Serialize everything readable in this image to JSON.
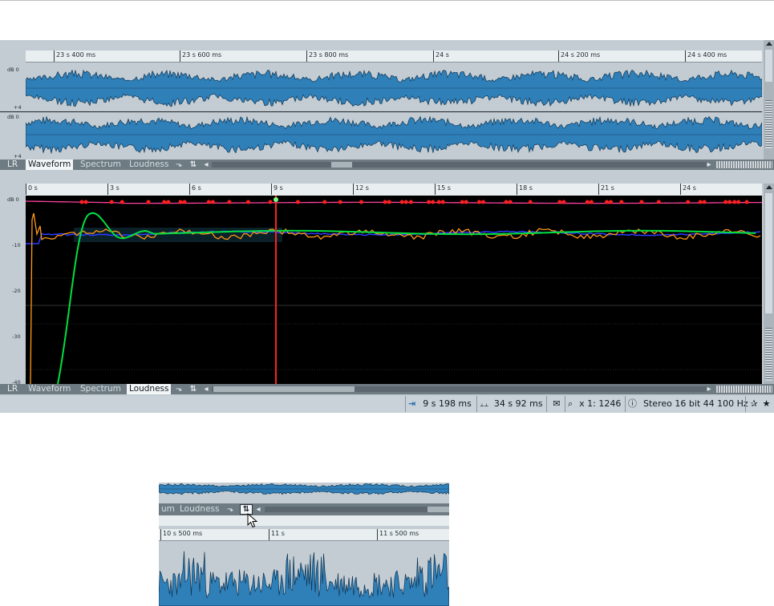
{
  "top_ruler": {
    "labels": [
      "23 s 400 ms",
      "23 s 600 ms",
      "23 s 800 ms",
      "24 s",
      "24 s 200 ms",
      "24 s 400 ms"
    ]
  },
  "top_channels": [
    {
      "top_label": "dB 0",
      "bottom_label": "+4"
    },
    {
      "top_label": "dB 0",
      "bottom_label": "+4"
    }
  ],
  "tabs_top": {
    "lr": "LR",
    "items": [
      "Waveform",
      "Spectrum",
      "Loudness"
    ],
    "active": "Waveform"
  },
  "tabs_bottom": {
    "lr": "LR",
    "items": [
      "Waveform",
      "Spectrum",
      "Loudness"
    ],
    "active": "Loudness"
  },
  "bottom_ruler": {
    "labels": [
      "0 s",
      "3 s",
      "6 s",
      "9 s",
      "12 s",
      "15 s",
      "18 s",
      "21 s",
      "24 s"
    ]
  },
  "loudness_axis": {
    "labels": [
      "dB 0",
      "-10",
      "-20",
      "-30",
      "-40"
    ]
  },
  "status": {
    "cursor_time": "9 s 198 ms",
    "length": "34 s 92 ms",
    "zoom": "x 1: 1246",
    "format": "Stereo 16 bit 44 100 Hz"
  },
  "status_icons": [
    "cursor-icon",
    "ruler-icon",
    "comment-icon",
    "zoom-icon",
    "info-icon",
    "star-outline-icon",
    "star-icon"
  ],
  "inset": {
    "tabs": [
      "um",
      "Loudness"
    ],
    "ruler_labels": [
      "10 s 500 ms",
      "11 s",
      "11 s 500 ms"
    ]
  },
  "colors": {
    "waveform_fill": "#2f7fb8",
    "waveform_edge": "#0e3554",
    "peak_markers": "#ff2020",
    "playhead": "#ff2020",
    "curve_green": "#00e040",
    "curve_orange": "#ff9a18",
    "curve_blue": "#2b3cff",
    "curve_magenta": "#ff40a0"
  }
}
